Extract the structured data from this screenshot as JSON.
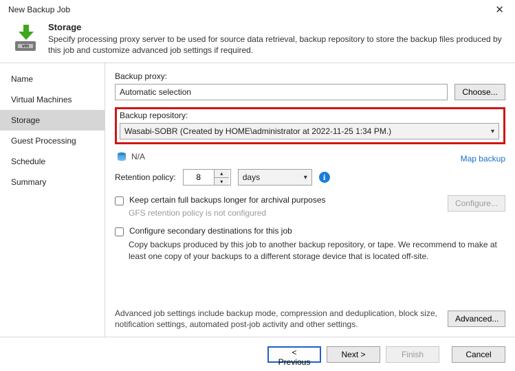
{
  "window": {
    "title": "New Backup Job"
  },
  "header": {
    "title": "Storage",
    "description": "Specify processing proxy server to be used for source data retrieval, backup repository to store the backup files produced by this job and customize advanced job settings if required."
  },
  "sidebar": {
    "items": [
      {
        "label": "Name",
        "selected": false
      },
      {
        "label": "Virtual Machines",
        "selected": false
      },
      {
        "label": "Storage",
        "selected": true
      },
      {
        "label": "Guest Processing",
        "selected": false
      },
      {
        "label": "Schedule",
        "selected": false
      },
      {
        "label": "Summary",
        "selected": false
      }
    ]
  },
  "content": {
    "proxy_label": "Backup proxy:",
    "proxy_value": "Automatic selection",
    "choose_label": "Choose...",
    "repo_label": "Backup repository:",
    "repo_value": "Wasabi-SOBR (Created by HOME\\administrator at 2022-11-25 1:34 PM.)",
    "capacity": "N/A",
    "map_label": "Map backup",
    "retention_label": "Retention policy:",
    "retention_value": "8",
    "retention_unit": "days",
    "gfs_check_label": "Keep certain full backups longer for archival purposes",
    "gfs_subtext": "GFS retention policy is not configured",
    "configure_label": "Configure...",
    "sec_check_label": "Configure secondary destinations for this job",
    "sec_desc": "Copy backups produced by this job to another backup repository, or tape. We recommend to make at least one copy of your backups to a different storage device that is located off-site.",
    "adv_text": "Advanced job settings include backup mode, compression and deduplication, block size, notification settings, automated post-job activity and other settings.",
    "advanced_label": "Advanced..."
  },
  "footer": {
    "previous": "< Previous",
    "next": "Next >",
    "finish": "Finish",
    "cancel": "Cancel"
  }
}
